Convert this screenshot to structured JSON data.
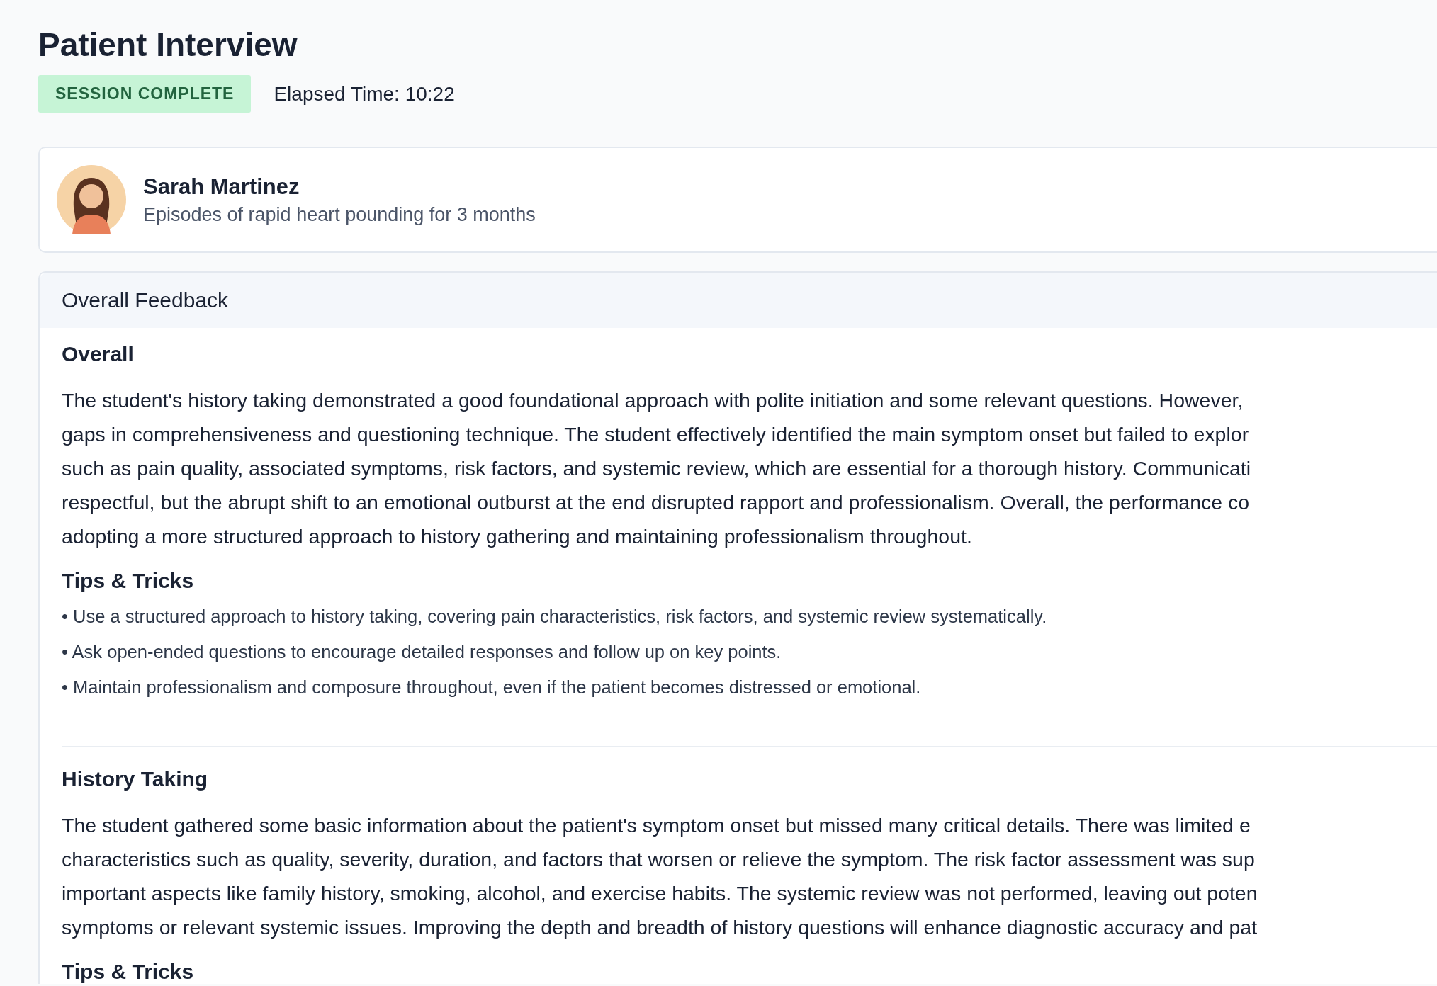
{
  "page": {
    "title": "Patient Interview",
    "status_badge": "SESSION COMPLETE",
    "elapsed_time": "Elapsed Time: 10:22"
  },
  "patient": {
    "name": "Sarah Martinez",
    "complaint": "Episodes of rapid heart pounding for 3 months"
  },
  "feedback": {
    "header": "Overall Feedback",
    "sections": [
      {
        "heading": "Overall",
        "paragraph_lines": [
          "The student's history taking demonstrated a good foundational approach with polite initiation and some relevant questions. However,",
          "gaps in comprehensiveness and questioning technique. The student effectively identified the main symptom onset but failed to explor",
          "such as pain quality, associated symptoms, risk factors, and systemic review, which are essential for a thorough history. Communicati",
          "respectful, but the abrupt shift to an emotional outburst at the end disrupted rapport and professionalism. Overall, the performance co",
          "adopting a more structured approach to history gathering and maintaining professionalism throughout."
        ],
        "tips_heading": "Tips & Tricks",
        "tips": [
          "• Use a structured approach to history taking, covering pain characteristics, risk factors, and systemic review systematically.",
          "• Ask open-ended questions to encourage detailed responses and follow up on key points.",
          "• Maintain professionalism and composure throughout, even if the patient becomes distressed or emotional."
        ]
      },
      {
        "heading": "History Taking",
        "paragraph_lines": [
          "The student gathered some basic information about the patient's symptom onset but missed many critical details. There was limited e",
          "characteristics such as quality, severity, duration, and factors that worsen or relieve the symptom. The risk factor assessment was sup",
          "important aspects like family history, smoking, alcohol, and exercise habits. The systemic review was not performed, leaving out poten",
          "symptoms or relevant systemic issues. Improving the depth and breadth of history questions will enhance diagnostic accuracy and pat"
        ],
        "tips_heading": "Tips & Tricks"
      }
    ]
  }
}
